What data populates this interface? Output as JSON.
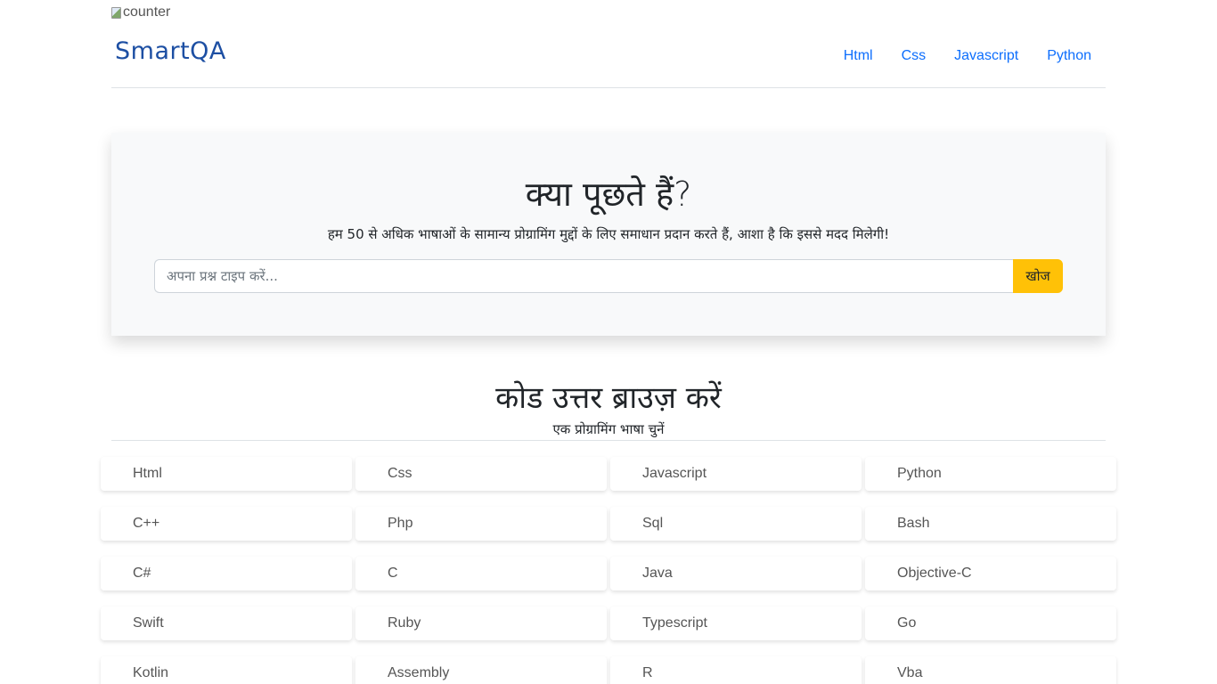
{
  "counter_alt": "counter",
  "brand": "SmartQA",
  "nav": [
    "Html",
    "Css",
    "Javascript",
    "Python"
  ],
  "hero": {
    "title": "क्या पूछते हैं?",
    "subtitle": "हम 50 से अधिक भाषाओं के सामान्य प्रोग्रामिंग मुद्दों के लिए समाधान प्रदान करते हैं, आशा है कि इससे मदद मिलेगी!",
    "search_placeholder": "अपना प्रश्न टाइप करें...",
    "search_button": "खोज"
  },
  "browse": {
    "title": "कोड उत्तर ब्राउज़ करें",
    "subtitle": "एक प्रोग्रामिंग भाषा चुनें"
  },
  "languages": [
    "Html",
    "Css",
    "Javascript",
    "Python",
    "C++",
    "Php",
    "Sql",
    "Bash",
    "C#",
    "C",
    "Java",
    "Objective-C",
    "Swift",
    "Ruby",
    "Typescript",
    "Go",
    "Kotlin",
    "Assembly",
    "R",
    "Vba"
  ],
  "colors": {
    "brand": "#1d4fa3",
    "link": "#0d6efd",
    "search_button": "#ffc107",
    "hero_bg": "#f8f9fa"
  }
}
